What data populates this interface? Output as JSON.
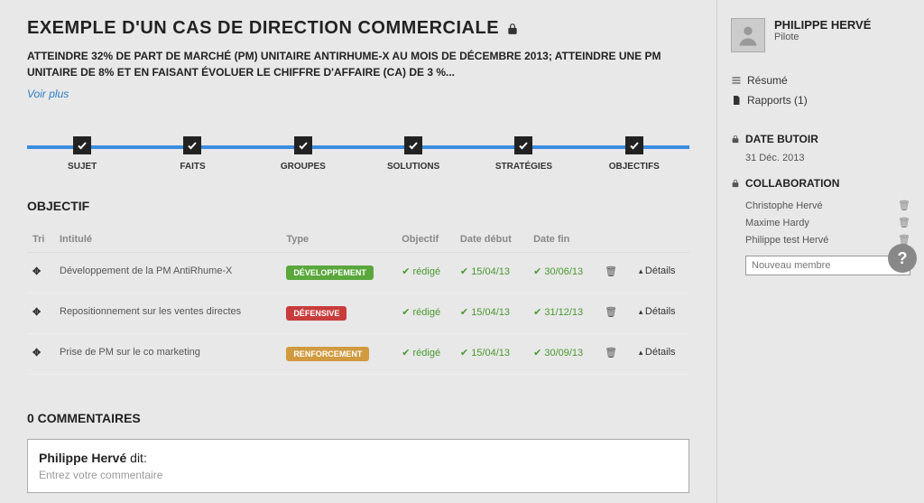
{
  "header": {
    "title": "EXEMPLE D'UN CAS DE DIRECTION COMMERCIALE",
    "subtitle": "ATTEINDRE 32% DE PART DE MARCHÉ (PM) UNITAIRE ANTIRHUME-X AU MOIS DE DÉCEMBRE 2013; ATTEINDRE UNE PM UNITAIRE DE 8% ET EN FAISANT ÉVOLUER LE CHIFFRE D'AFFAIRE (CA) DE 3 %...",
    "see_more": "Voir plus"
  },
  "timeline": {
    "steps": [
      "SUJET",
      "FAITS",
      "GROUPES",
      "SOLUTIONS",
      "STRATÉGIES",
      "OBJECTIFS"
    ]
  },
  "objectives": {
    "title": "OBJECTIF",
    "columns": {
      "tri": "Tri",
      "intitule": "Intitulé",
      "type": "Type",
      "objectif": "Objectif",
      "date_debut": "Date début",
      "date_fin": "Date fin"
    },
    "rows": [
      {
        "intitule": "Développement de la PM AntiRhume-X",
        "type": "DÉVELOPPEMENT",
        "type_class": "dev",
        "objectif": "rédigé",
        "date_debut": "15/04/13",
        "date_fin": "30/06/13"
      },
      {
        "intitule": "Repositionnement sur les ventes directes",
        "type": "DÉFENSIVE",
        "type_class": "def",
        "objectif": "rédigé",
        "date_debut": "15/04/13",
        "date_fin": "31/12/13"
      },
      {
        "intitule": "Prise de PM sur le co marketing",
        "type": "RENFORCEMENT",
        "type_class": "ren",
        "objectif": "rédigé",
        "date_debut": "15/04/13",
        "date_fin": "30/09/13"
      }
    ],
    "details_label": "Détails"
  },
  "comments": {
    "title": "0 COMMENTAIRES",
    "author": "Philippe Hervé",
    "says": "dit:",
    "placeholder": "Entrez votre commentaire"
  },
  "sidebar": {
    "profile_name": "PHILIPPE HERVÉ",
    "profile_role": "Pilote",
    "link_resume": "Résumé",
    "link_rapports": "Rapports (1)",
    "deadline_label": "DATE BUTOIR",
    "deadline_value": "31 Déc. 2013",
    "collab_label": "COLLABORATION",
    "collaborators": [
      "Christophe Hervé",
      "Maxime Hardy",
      "Philippe test Hervé"
    ],
    "new_member_placeholder": "Nouveau membre"
  }
}
